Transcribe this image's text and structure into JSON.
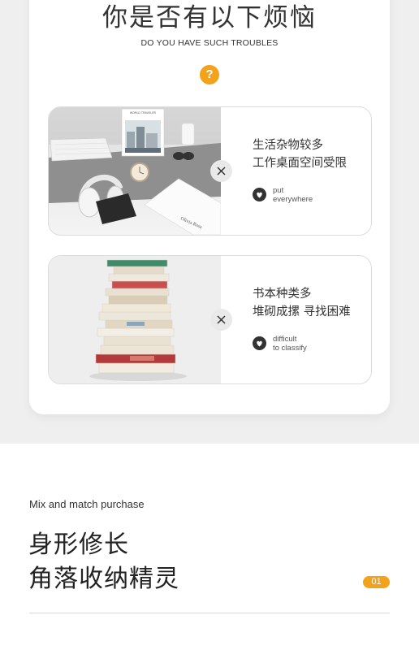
{
  "header": {
    "title": "你是否有以下烦恼",
    "subtitle": "DO YOU HAVE SUCH TROUBLES",
    "question_symbol": "?"
  },
  "cards": [
    {
      "lines": [
        "生活杂物较多",
        "工作桌面空间受限"
      ],
      "english": [
        "put",
        "everywhere"
      ],
      "image_text": [
        "WORLD TRAVELER",
        "Olivia Rose"
      ]
    },
    {
      "lines": [
        "书本种类多",
        "堆砌成摞 寻找困难"
      ],
      "english": [
        "difficult",
        "to classify"
      ]
    }
  ],
  "section": {
    "kicker": "Mix and match purchase",
    "heading_lines": [
      "身形修长",
      "角落收纳精灵"
    ],
    "badge": "01"
  },
  "colors": {
    "accent": "#f3a21c",
    "page_background": "#efefef",
    "panel": "#ffffff"
  },
  "icons": [
    "question-icon",
    "close-icon",
    "heart-icon"
  ]
}
